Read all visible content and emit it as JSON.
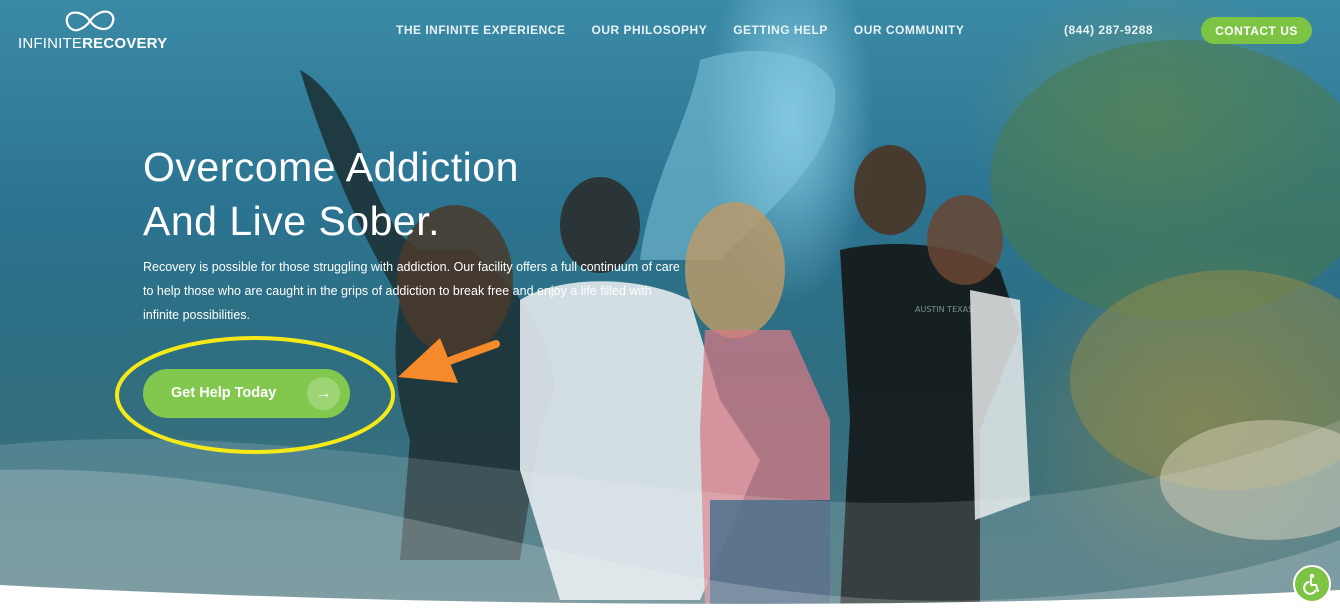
{
  "header": {
    "logo": {
      "text_light": "INFINITE",
      "text_bold": "RECOVERY",
      "icon": "infinity-icon"
    },
    "nav": [
      {
        "label": "THE INFINITE EXPERIENCE"
      },
      {
        "label": "OUR PHILOSOPHY"
      },
      {
        "label": "GETTING HELP"
      },
      {
        "label": "OUR COMMUNITY"
      }
    ],
    "phone": "(844) 287-9288",
    "contact_label": "CONTACT US"
  },
  "hero": {
    "headline_line1": "Overcome Addiction",
    "headline_line2": "And Live Sober.",
    "subtext": "Recovery is possible for those struggling with addiction. Our facility offers a full continuum of care to help those who are caught in the grips of addiction to break free and enjoy a life filled with infinite possibilities.",
    "cta_label": "Get Help Today",
    "cta_icon": "arrow-right-icon",
    "shirt_print": "AUSTIN TEXAS"
  },
  "annotation": {
    "highlight_color": "#f5ea18",
    "arrow_color": "#f58a2a"
  },
  "colors": {
    "accent_green": "#7dc444",
    "nav_text": "#e8f3f6"
  },
  "accessibility": {
    "icon": "accessibility-icon"
  }
}
